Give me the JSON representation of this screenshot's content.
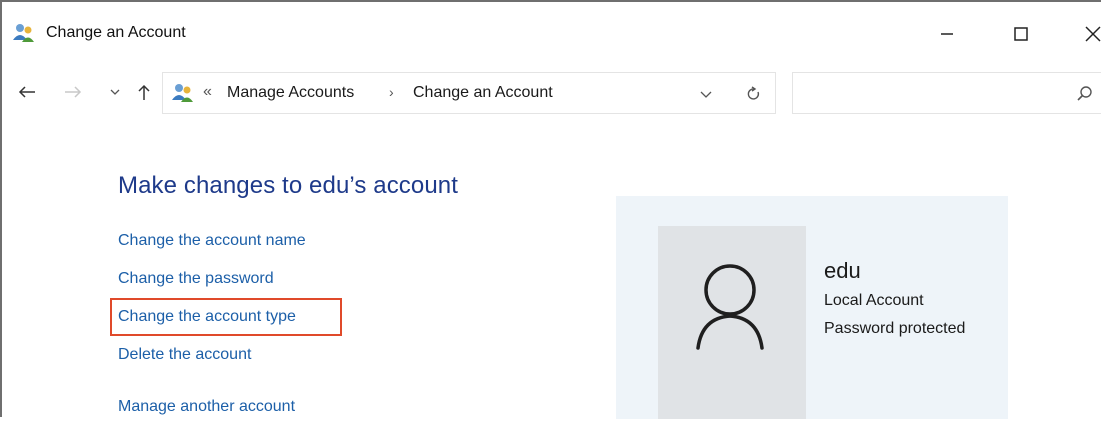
{
  "window": {
    "title": "Change an Account",
    "controls": {
      "minimize": "minimize",
      "maximize": "maximize",
      "close": "close"
    }
  },
  "address_bar": {
    "overflow": "«",
    "breadcrumbs": [
      "Manage Accounts",
      "Change an Account"
    ],
    "separator": "›"
  },
  "search": {
    "placeholder": ""
  },
  "main": {
    "heading": "Make changes to edu’s account",
    "links": [
      "Change the account name",
      "Change the password",
      "Change the account type",
      "Delete the account",
      "Manage another account"
    ],
    "highlighted_link_index": 2
  },
  "account": {
    "name": "edu",
    "type": "Local Account",
    "status": "Password protected"
  },
  "colors": {
    "link": "#1c5fa8",
    "heading": "#1e3a8a",
    "highlight_box": "#e04a2a",
    "card_bg": "#eef4f9"
  },
  "icons": {
    "title": "users-icon",
    "back": "arrow-left-icon",
    "forward": "arrow-right-icon",
    "recent": "chevron-down-icon",
    "up": "arrow-up-icon",
    "address": "users-icon",
    "dropdown": "chevron-down-icon",
    "refresh": "refresh-icon",
    "search": "search-icon",
    "avatar": "user-avatar-icon"
  }
}
